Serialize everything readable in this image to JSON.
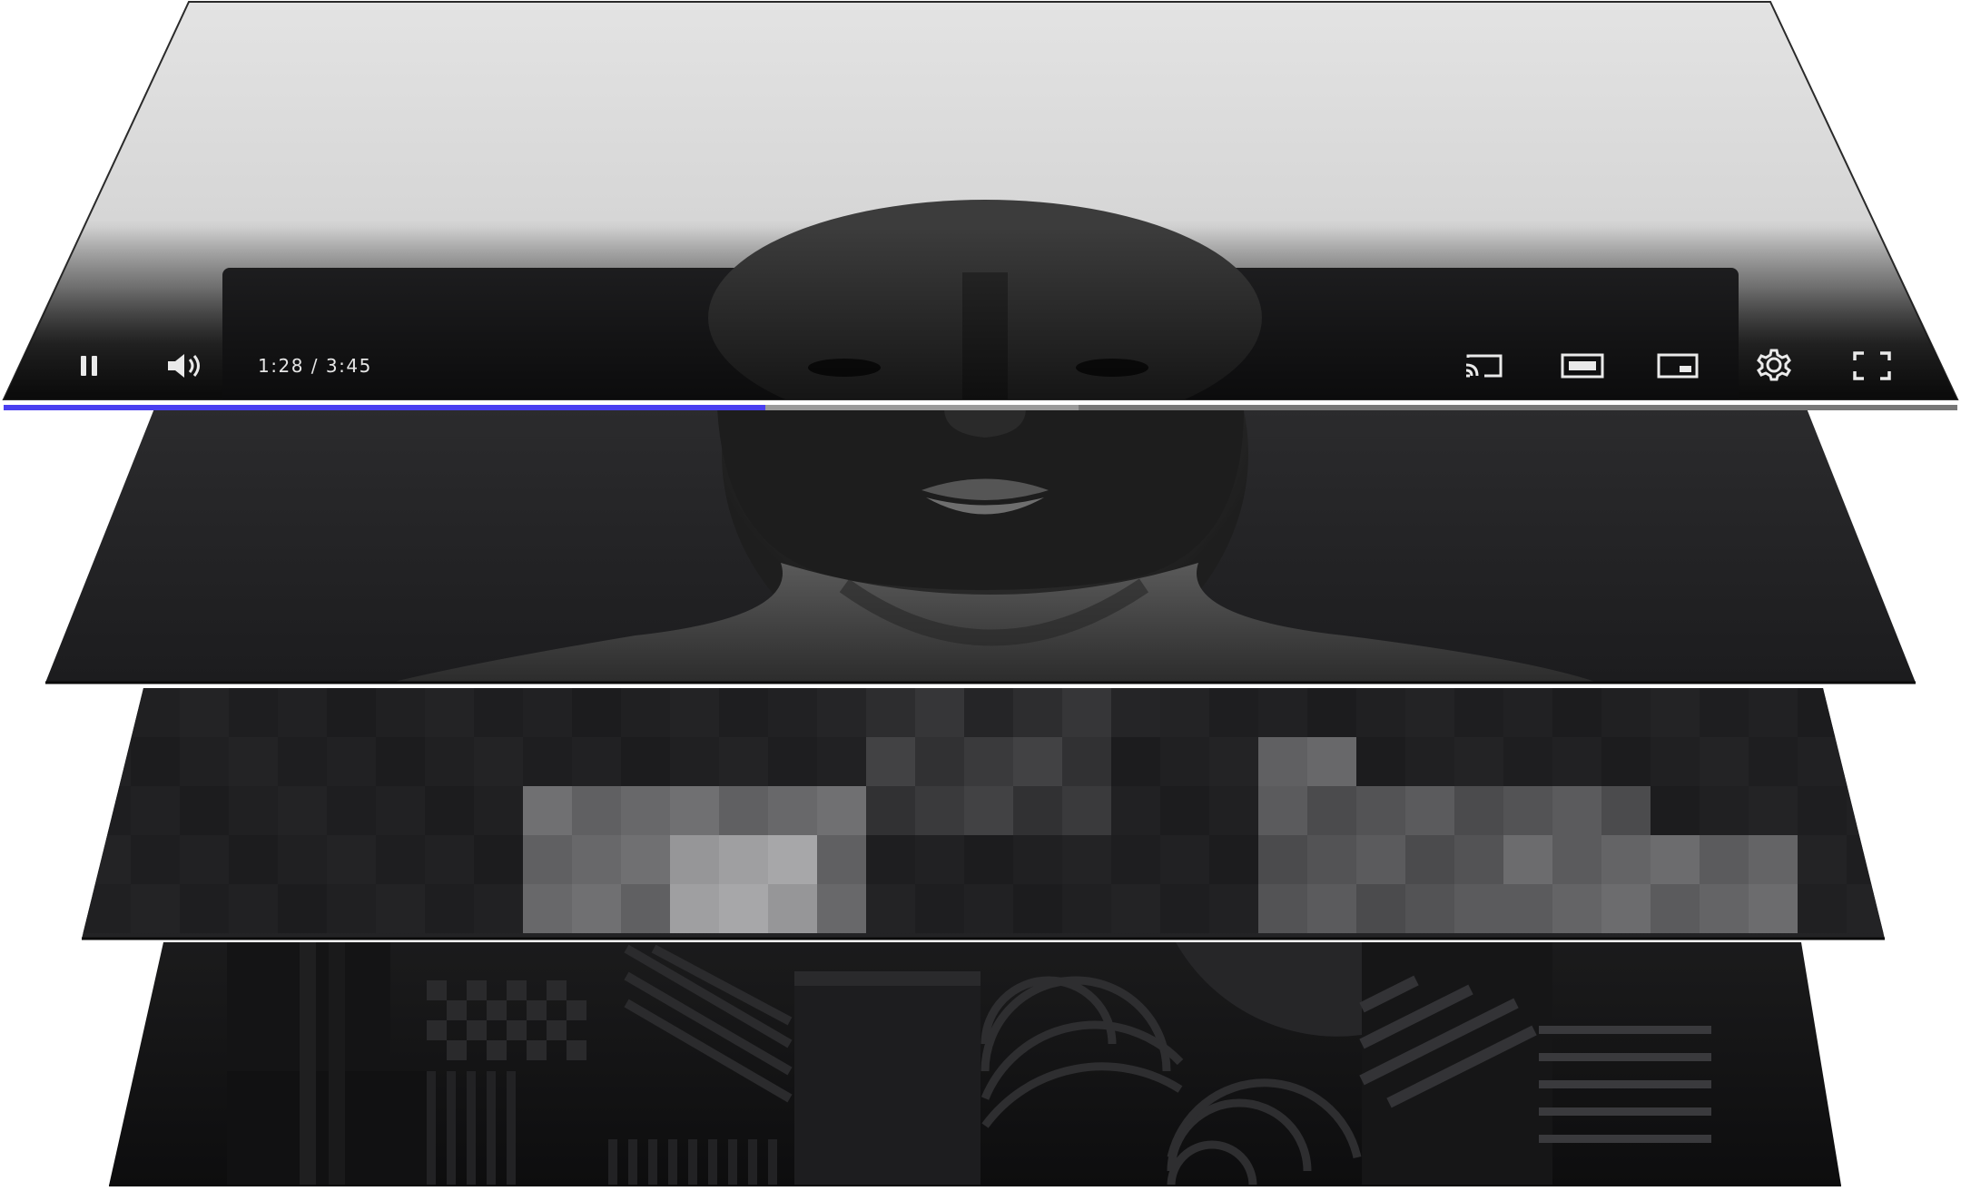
{
  "player": {
    "time_current": "1:28",
    "time_separator": " / ",
    "time_total": "3:45",
    "progress_fraction": 0.39,
    "buffer_fraction": 0.55,
    "accent_color": "#4a3ff0"
  },
  "controls": {
    "left": [
      {
        "name": "pause-button",
        "icon": "pause-icon"
      },
      {
        "name": "volume-button",
        "icon": "volume-icon"
      }
    ],
    "right": [
      {
        "name": "cast-button",
        "icon": "cast-icon"
      },
      {
        "name": "theater-mode-button",
        "icon": "theater-mode-icon"
      },
      {
        "name": "miniplayer-button",
        "icon": "miniplayer-icon"
      },
      {
        "name": "settings-button",
        "icon": "gear-icon"
      },
      {
        "name": "fullscreen-button",
        "icon": "fullscreen-icon"
      }
    ]
  },
  "layers": [
    "player-controls-layer",
    "video-frame-layer",
    "pixelated-encoding-layer",
    "geometric-base-layer"
  ]
}
